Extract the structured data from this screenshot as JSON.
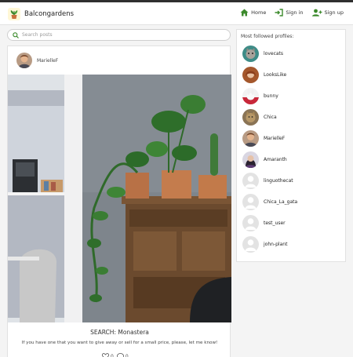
{
  "brand": {
    "name": "Balcongardens"
  },
  "nav": {
    "home": "Home",
    "signin": "Sign in",
    "signup": "Sign up"
  },
  "search": {
    "placeholder": "Search posts",
    "value": ""
  },
  "post": {
    "author": "MarielleF",
    "title": "SEARCH: Monastera",
    "body": "If you have one that you want to give away or sell for a small price, please, let me know!",
    "likes": "0",
    "comments": "0"
  },
  "sidebar": {
    "title": "Most followed profiles:",
    "profiles": [
      {
        "name": "lovecats",
        "avatar": "photo"
      },
      {
        "name": "LooksLike",
        "avatar": "photo"
      },
      {
        "name": "bunny",
        "avatar": "photo"
      },
      {
        "name": "Chica",
        "avatar": "photo"
      },
      {
        "name": "MarielleF",
        "avatar": "photo"
      },
      {
        "name": "Amaranth",
        "avatar": "photo"
      },
      {
        "name": "linguothecat",
        "avatar": "default"
      },
      {
        "name": "Chica_La_gata",
        "avatar": "default"
      },
      {
        "name": "test_user",
        "avatar": "default"
      },
      {
        "name": "john-plant",
        "avatar": "default"
      }
    ]
  },
  "colors": {
    "accent": "#3c8a2c",
    "navbar": "#ffffff",
    "background": "#f4f4f4"
  },
  "icons": [
    "plant-logo-icon",
    "home-icon",
    "sign-in-icon",
    "user-plus-icon",
    "search-icon",
    "heart-icon",
    "comment-icon",
    "default-avatar-icon"
  ]
}
